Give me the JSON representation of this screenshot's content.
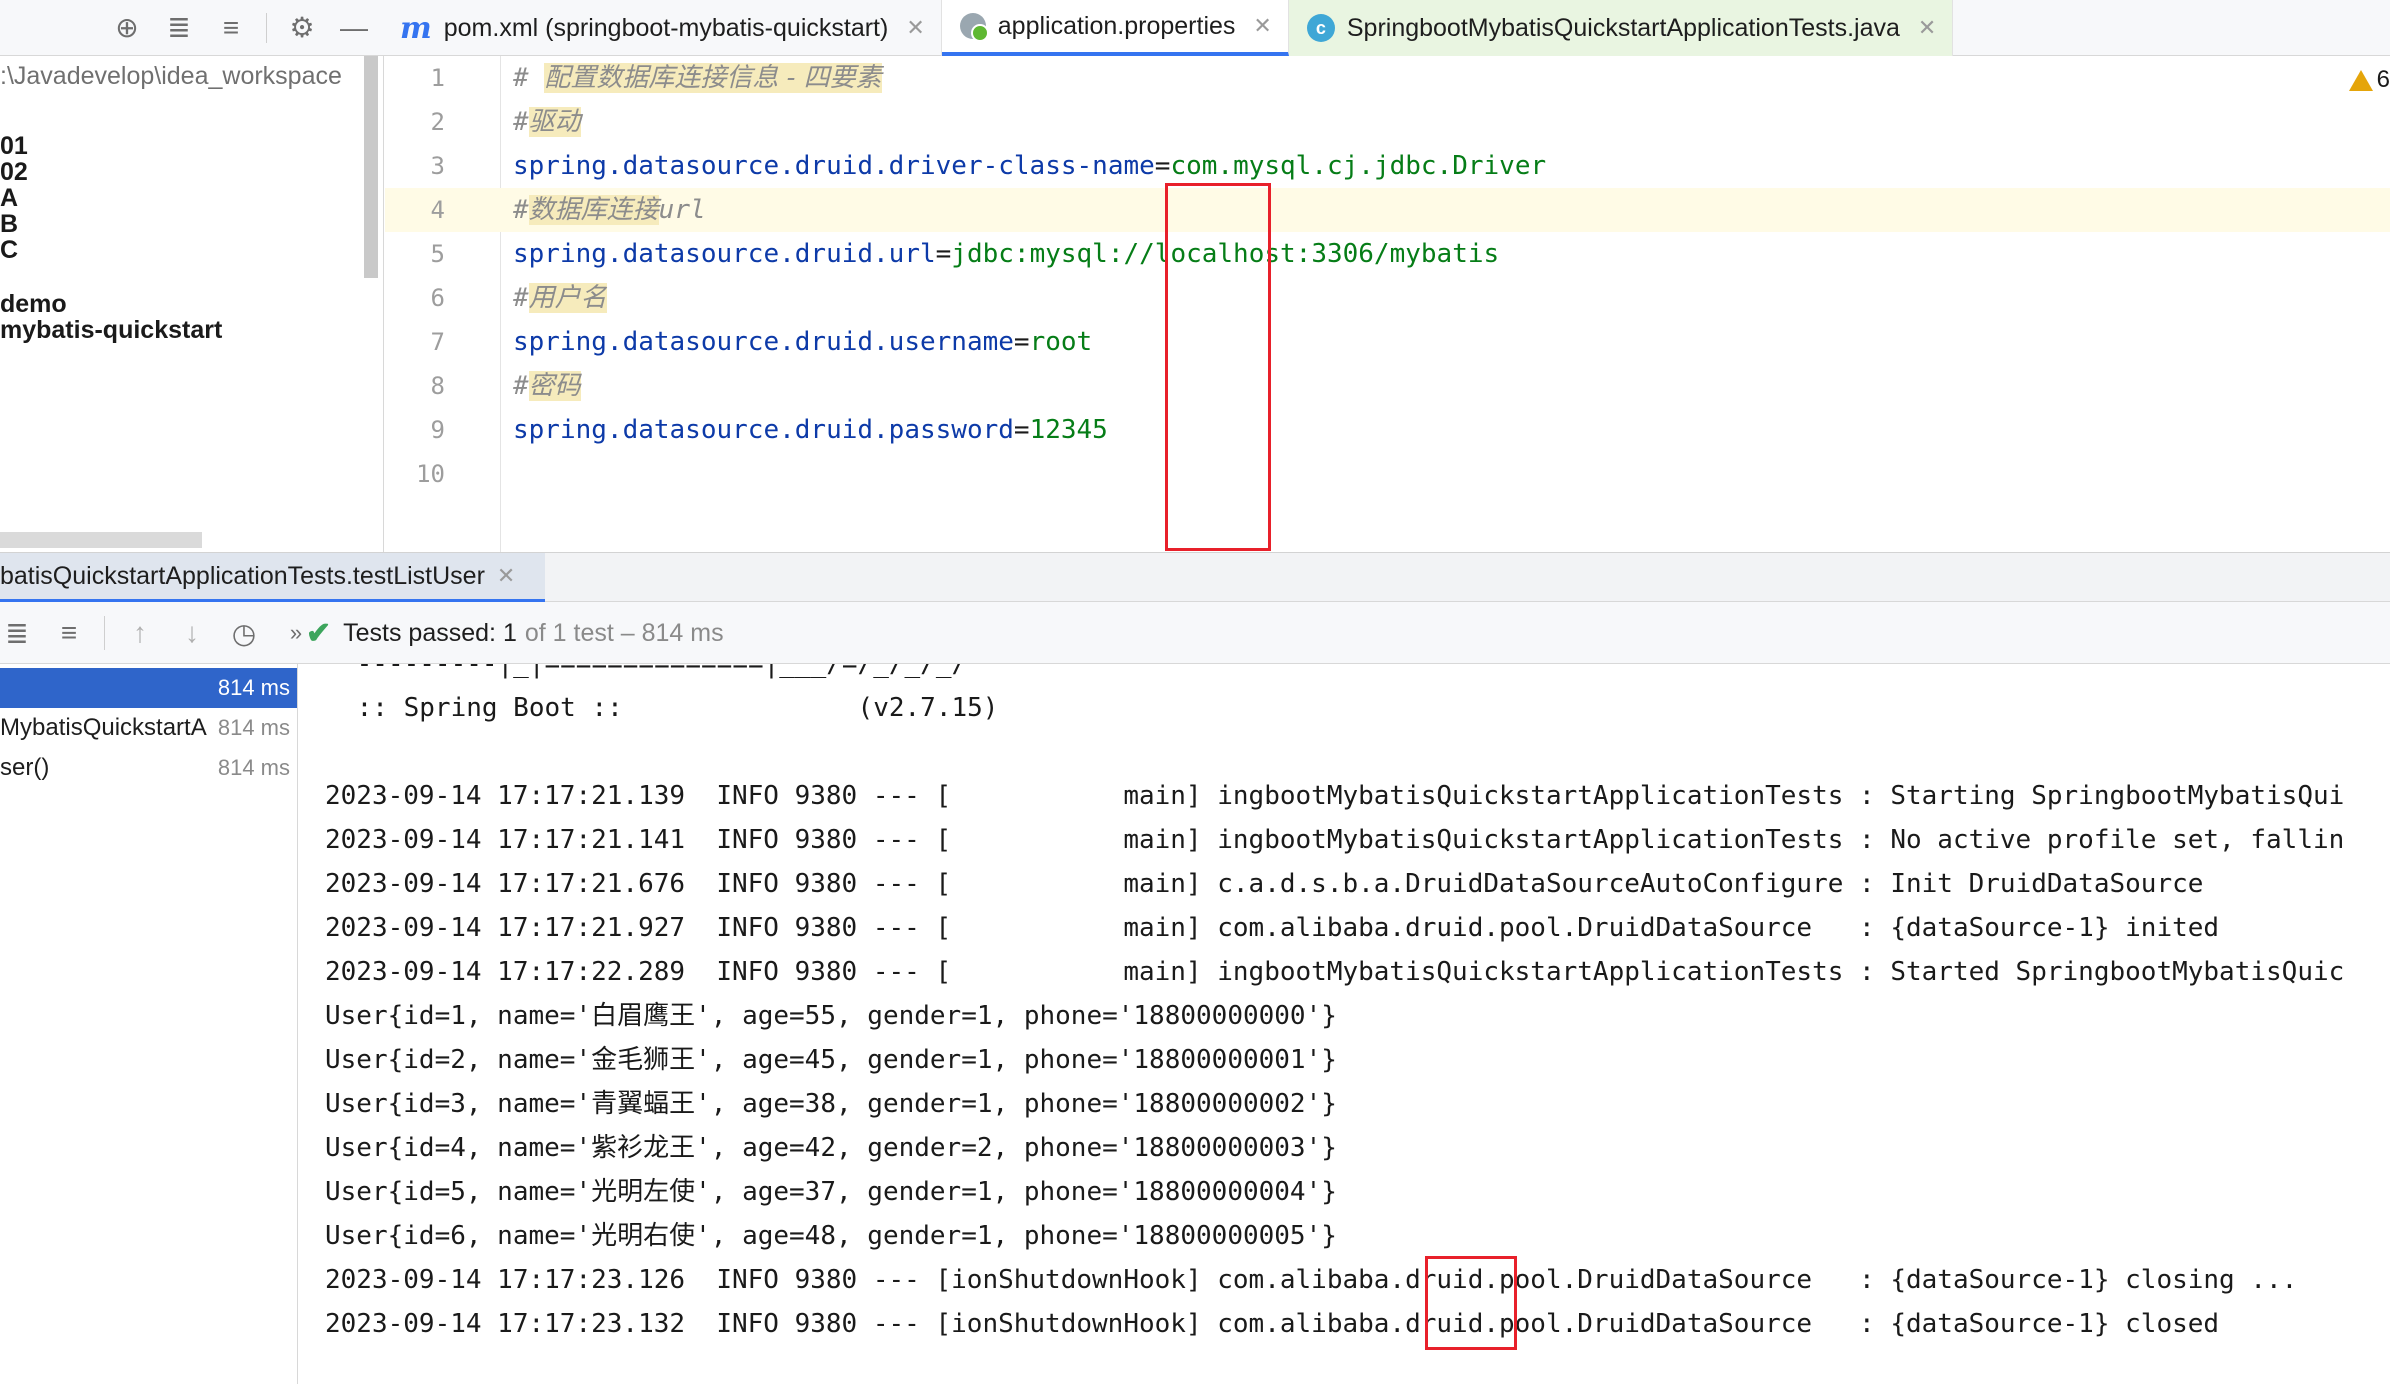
{
  "toolbar": {
    "icons": [
      "locate-icon",
      "expand-all-icon",
      "collapse-all-icon",
      "gear-icon",
      "minimize-icon"
    ]
  },
  "tabs": [
    {
      "label": "pom.xml (springboot-mybatis-quickstart)",
      "icon": "maven-icon"
    },
    {
      "label": "application.properties",
      "icon": "properties-file-icon"
    },
    {
      "label": "SpringbootMybatisQuickstartApplicationTests.java",
      "icon": "java-class-icon"
    }
  ],
  "project": {
    "path": ":\\Javadevelop\\idea_workspace",
    "items": [
      "01",
      "02",
      "A",
      "B",
      "C",
      "demo",
      "mybatis-quickstart"
    ]
  },
  "editor": {
    "warning_count": "6",
    "lines": [
      {
        "n": "1",
        "comment": "配置数据库连接信息 - 四要素",
        "comment_prefix": "# "
      },
      {
        "n": "2",
        "comment": "驱动",
        "comment_prefix": "#"
      },
      {
        "n": "3",
        "key": "spring.datasource.druid.driver-class-name",
        "value": "com.mysql.cj.jdbc.Driver"
      },
      {
        "n": "4",
        "comment": "数据库连接",
        "comment_tail": "url",
        "comment_prefix": "#"
      },
      {
        "n": "5",
        "key": "spring.datasource.druid.url",
        "value": "jdbc:mysql://localhost:3306/mybatis"
      },
      {
        "n": "6",
        "comment": "用户名",
        "comment_prefix": "#"
      },
      {
        "n": "7",
        "key": "spring.datasource.druid.username",
        "value": "root"
      },
      {
        "n": "8",
        "comment": "密码",
        "comment_prefix": "#"
      },
      {
        "n": "9",
        "key": "spring.datasource.druid.password",
        "value": "12345"
      },
      {
        "n": "10"
      }
    ]
  },
  "run": {
    "tab_label": "batisQuickstartApplicationTests.testListUser",
    "status_passed": "Tests passed: 1",
    "status_detail": "of 1 test – 814 ms",
    "tree": [
      {
        "name": "",
        "time": "814 ms",
        "selected": true
      },
      {
        "name": "MybatisQuickstartA",
        "time": "814 ms"
      },
      {
        "name": "ser()",
        "time": "814 ms"
      }
    ],
    "console": [
      " ---------|_|==============|___/=/_/_/_/",
      " :: Spring Boot ::               (v2.7.15)",
      "",
      "2023-09-14 17:17:21.139  INFO 9380 --- [           main] ingbootMybatisQuickstartApplicationTests : Starting SpringbootMybatisQui",
      "2023-09-14 17:17:21.141  INFO 9380 --- [           main] ingbootMybatisQuickstartApplicationTests : No active profile set, fallin",
      "2023-09-14 17:17:21.676  INFO 9380 --- [           main] c.a.d.s.b.a.DruidDataSourceAutoConfigure : Init DruidDataSource",
      "2023-09-14 17:17:21.927  INFO 9380 --- [           main] com.alibaba.druid.pool.DruidDataSource   : {dataSource-1} inited",
      "2023-09-14 17:17:22.289  INFO 9380 --- [           main] ingbootMybatisQuickstartApplicationTests : Started SpringbootMybatisQuic",
      "User{id=1, name='白眉鹰王', age=55, gender=1, phone='18800000000'}",
      "User{id=2, name='金毛狮王', age=45, gender=1, phone='18800000001'}",
      "User{id=3, name='青翼蝠王', age=38, gender=1, phone='18800000002'}",
      "User{id=4, name='紫衫龙王', age=42, gender=2, phone='18800000003'}",
      "User{id=5, name='光明左使', age=37, gender=1, phone='18800000004'}",
      "User{id=6, name='光明右使', age=48, gender=1, phone='18800000005'}",
      "2023-09-14 17:17:23.126  INFO 9380 --- [ionShutdownHook] com.alibaba.druid.pool.DruidDataSource   : {dataSource-1} closing ...",
      "2023-09-14 17:17:23.132  INFO 9380 --- [ionShutdownHook] com.alibaba.druid.pool.DruidDataSource   : {dataSource-1} closed"
    ]
  },
  "colors": {
    "highlight_box": "#e8202a",
    "selection": "#2f65ca",
    "passed": "#3ca55c",
    "keyword": "#0d3aa8",
    "string_value": "#067d17"
  }
}
